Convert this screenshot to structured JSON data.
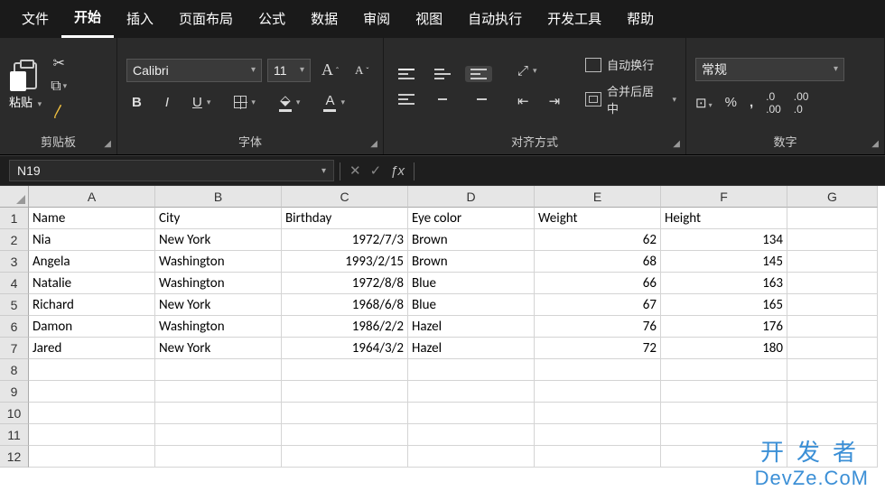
{
  "tabs": [
    "文件",
    "开始",
    "插入",
    "页面布局",
    "公式",
    "数据",
    "审阅",
    "视图",
    "自动执行",
    "开发工具",
    "帮助"
  ],
  "activeTab": 1,
  "ribbon": {
    "clipboard": {
      "label": "粘贴",
      "group": "剪贴板"
    },
    "font": {
      "name": "Calibri",
      "size": "11",
      "group": "字体"
    },
    "align": {
      "wrap": "自动换行",
      "merge": "合并后居中",
      "group": "对齐方式"
    },
    "number": {
      "format": "常规",
      "group": "数字"
    }
  },
  "namebox": "N19",
  "headers": [
    "A",
    "B",
    "C",
    "D",
    "E",
    "F",
    "G"
  ],
  "rownums": [
    "1",
    "2",
    "3",
    "4",
    "5",
    "6",
    "7",
    "8",
    "9",
    "10",
    "11",
    "12"
  ],
  "data": [
    [
      "Name",
      "City",
      "Birthday",
      "Eye color",
      "Weight",
      "Height",
      ""
    ],
    [
      "Nia",
      "New York",
      "1972/7/3",
      "Brown",
      "62",
      "134",
      ""
    ],
    [
      "Angela",
      "Washington",
      "1993/2/15",
      "Brown",
      "68",
      "145",
      ""
    ],
    [
      "Natalie",
      "Washington",
      "1972/8/8",
      "Blue",
      "66",
      "163",
      ""
    ],
    [
      "Richard",
      "New York",
      "1968/6/8",
      "Blue",
      "67",
      "165",
      ""
    ],
    [
      "Damon",
      "Washington",
      "1986/2/2",
      "Hazel",
      "76",
      "176",
      ""
    ],
    [
      "Jared",
      "New York",
      "1964/3/2",
      "Hazel",
      "72",
      "180",
      ""
    ],
    [
      "",
      "",
      "",
      "",
      "",
      "",
      ""
    ],
    [
      "",
      "",
      "",
      "",
      "",
      "",
      ""
    ],
    [
      "",
      "",
      "",
      "",
      "",
      "",
      ""
    ],
    [
      "",
      "",
      "",
      "",
      "",
      "",
      ""
    ],
    [
      "",
      "",
      "",
      "",
      "",
      "",
      ""
    ]
  ],
  "rightAlign": {
    "0": [],
    "1": [
      2,
      4,
      5
    ],
    "2": [
      2,
      4,
      5
    ],
    "3": [
      2,
      4,
      5
    ],
    "4": [
      2,
      4,
      5
    ],
    "5": [
      2,
      4,
      5
    ],
    "6": [
      2,
      4,
      5
    ]
  },
  "watermark": {
    "l1": "开发者",
    "l2": "DevZe.CoM"
  }
}
